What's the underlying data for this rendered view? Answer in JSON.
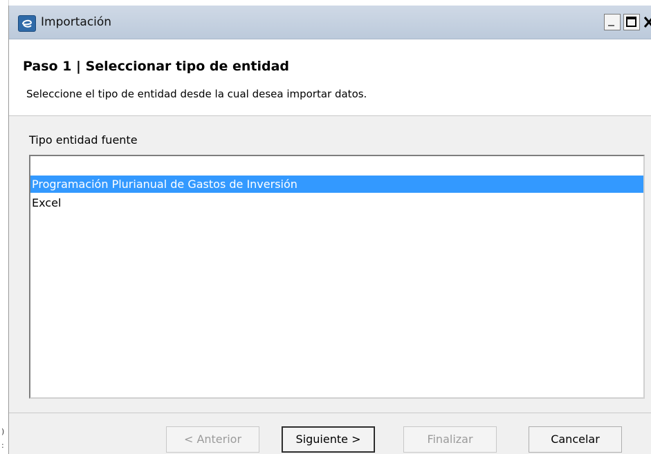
{
  "window": {
    "title": "Importación"
  },
  "header": {
    "step_title": "Paso 1 | Seleccionar tipo de entidad",
    "description": "Seleccione el tipo de entidad desde la cual desea importar datos."
  },
  "form": {
    "label": "Tipo entidad fuente",
    "items": [
      {
        "label": "Programación Plurianual de Gastos de Inversión",
        "selected": true
      },
      {
        "label": "Excel",
        "selected": false
      }
    ]
  },
  "buttons": {
    "previous": "< Anterior",
    "next": "Siguiente >",
    "finish": "Finalizar",
    "cancel": "Cancelar"
  },
  "colors": {
    "selection": "#3399ff",
    "titlebar": "#c3cfdd"
  },
  "background": {
    "edge_chars": [
      ")",
      ":"
    ]
  }
}
